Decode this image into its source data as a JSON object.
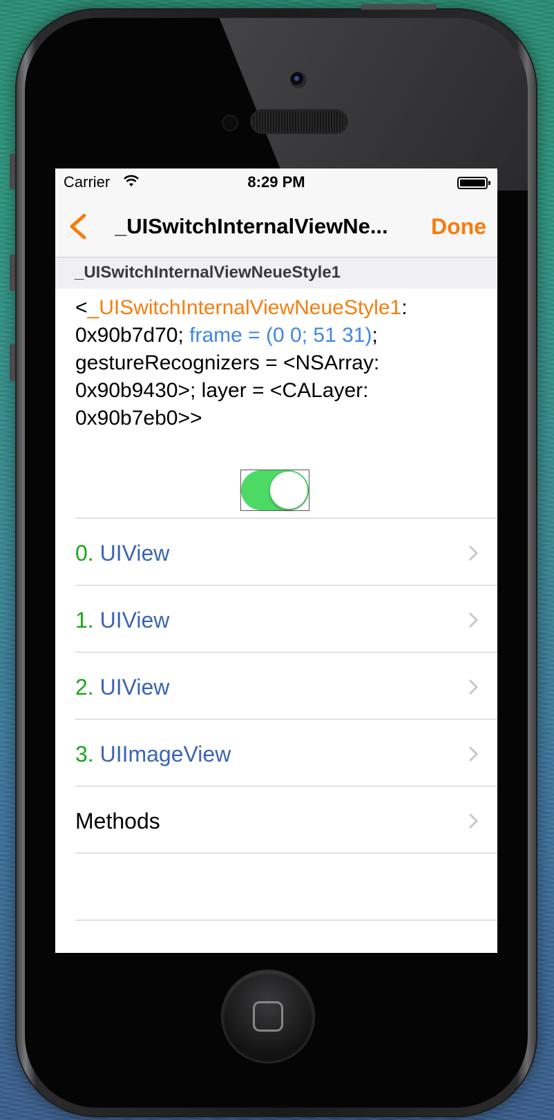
{
  "status_bar": {
    "carrier": "Carrier",
    "time": "8:29 PM"
  },
  "nav": {
    "title": "_UISwitchInternalViewNe...",
    "done_label": "Done"
  },
  "section": {
    "header": "_UISwitchInternalViewNeueStyle1"
  },
  "description": {
    "prefix": "<",
    "class_name": "_UISwitchInternalViewNeueStyle1",
    "colon": ":",
    "address": "0x90b7d70;",
    "frame": "frame = (0 0; 51 31)",
    "semicolon": ";",
    "rest": "gestureRecognizers = <NSArray: 0x90b9430>; layer = <CALayer: 0x90b7eb0>>"
  },
  "preview_switch": {
    "on": true
  },
  "rows": [
    {
      "index": "0.",
      "label": "UIView"
    },
    {
      "index": "1.",
      "label": "UIView"
    },
    {
      "index": "2.",
      "label": "UIView"
    },
    {
      "index": "3.",
      "label": "UIImageView"
    }
  ],
  "methods_label": "Methods",
  "colors": {
    "accent": "#f77c0e",
    "frame_blue": "#3f86e8",
    "index_green": "#1aa51a",
    "class_blue": "#3b65b2",
    "switch_green": "#4cd964"
  }
}
